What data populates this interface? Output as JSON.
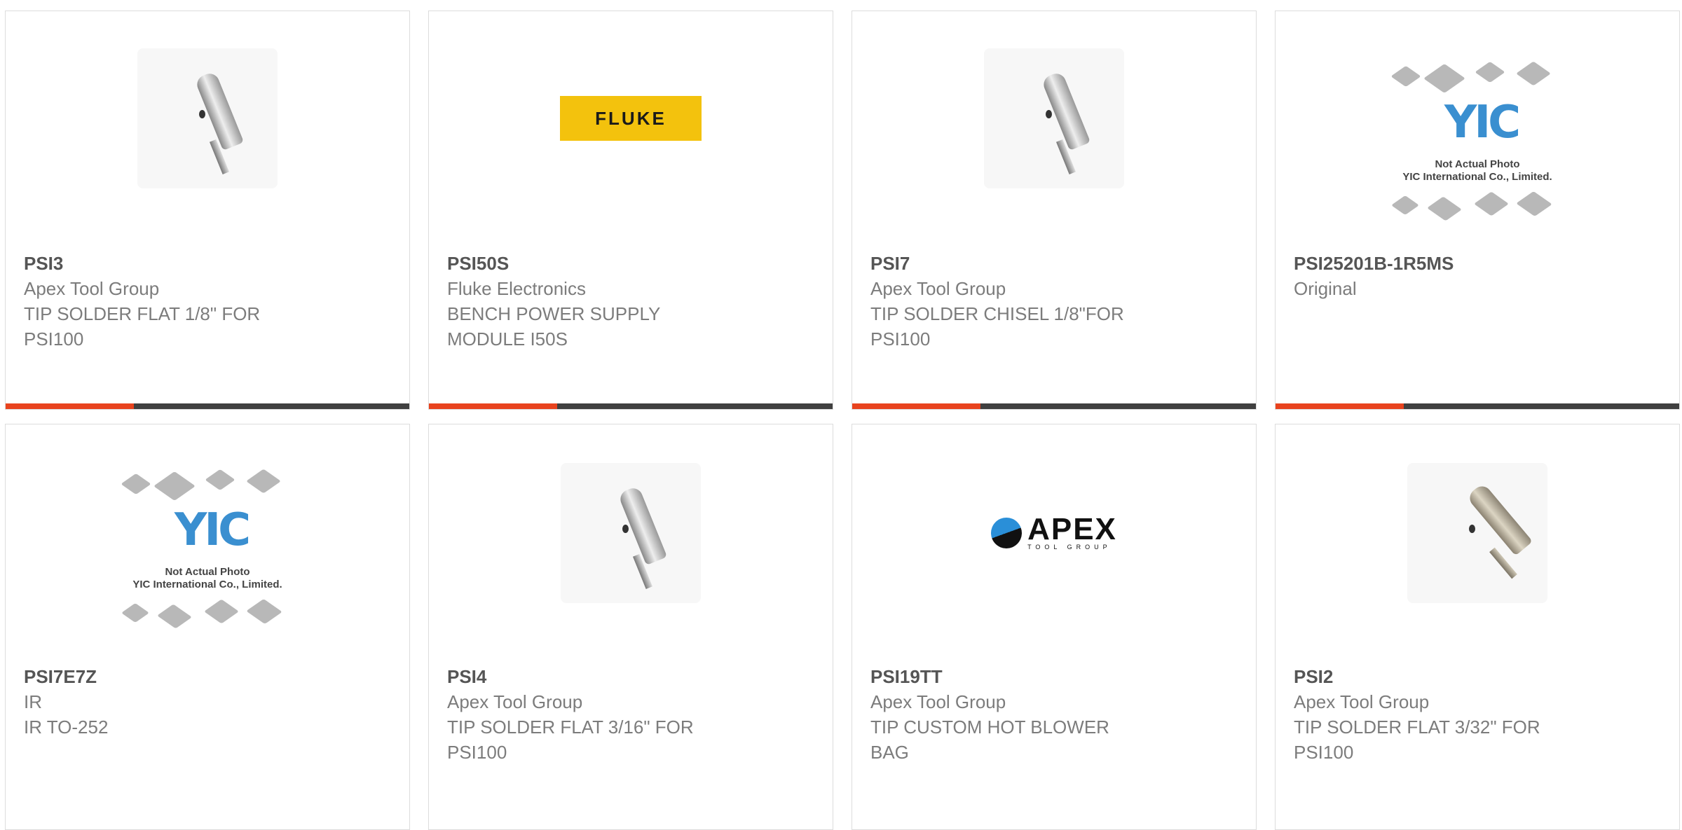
{
  "products": [
    {
      "part": "PSI3",
      "brand": "Apex Tool Group",
      "desc1": "TIP SOLDER FLAT 1/8\" FOR",
      "desc2": "PSI100",
      "image": "solder-tip-photo"
    },
    {
      "part": "PSI50S",
      "brand": "Fluke Electronics",
      "desc1": "BENCH POWER SUPPLY",
      "desc2": "MODULE I50S",
      "image": "fluke-logo",
      "logo_text": "FLUKE"
    },
    {
      "part": "PSI7",
      "brand": "Apex Tool Group",
      "desc1": "TIP SOLDER CHISEL 1/8\"FOR",
      "desc2": "PSI100",
      "image": "solder-tip-photo"
    },
    {
      "part": "PSI25201B-1R5MS",
      "brand": "Original",
      "desc1": "",
      "desc2": "",
      "image": "yic-placeholder",
      "placeholder_line1": "Not Actual Photo",
      "placeholder_line2": "YIC International Co., Limited."
    },
    {
      "part": "PSI7E7Z",
      "brand": "IR",
      "desc1": "IR TO-252",
      "desc2": "",
      "image": "yic-placeholder",
      "placeholder_line1": "Not Actual Photo",
      "placeholder_line2": "YIC International Co., Limited."
    },
    {
      "part": "PSI4",
      "brand": "Apex Tool Group",
      "desc1": "TIP SOLDER FLAT 3/16\" FOR",
      "desc2": "PSI100",
      "image": "solder-tip-photo"
    },
    {
      "part": "PSI19TT",
      "brand": "Apex Tool Group",
      "desc1": "TIP CUSTOM HOT BLOWER",
      "desc2": "BAG",
      "image": "apex-logo",
      "logo_text": "APEX",
      "logo_sub": "TOOL GROUP"
    },
    {
      "part": "PSI2",
      "brand": "Apex Tool Group",
      "desc1": "TIP SOLDER FLAT 3/32\" FOR",
      "desc2": "PSI100",
      "image": "solder-tip-photo"
    }
  ],
  "yic_mark": "YIC",
  "colors": {
    "accent": "#e8431e",
    "bar": "#404040",
    "fluke_yellow": "#f3c20d"
  }
}
